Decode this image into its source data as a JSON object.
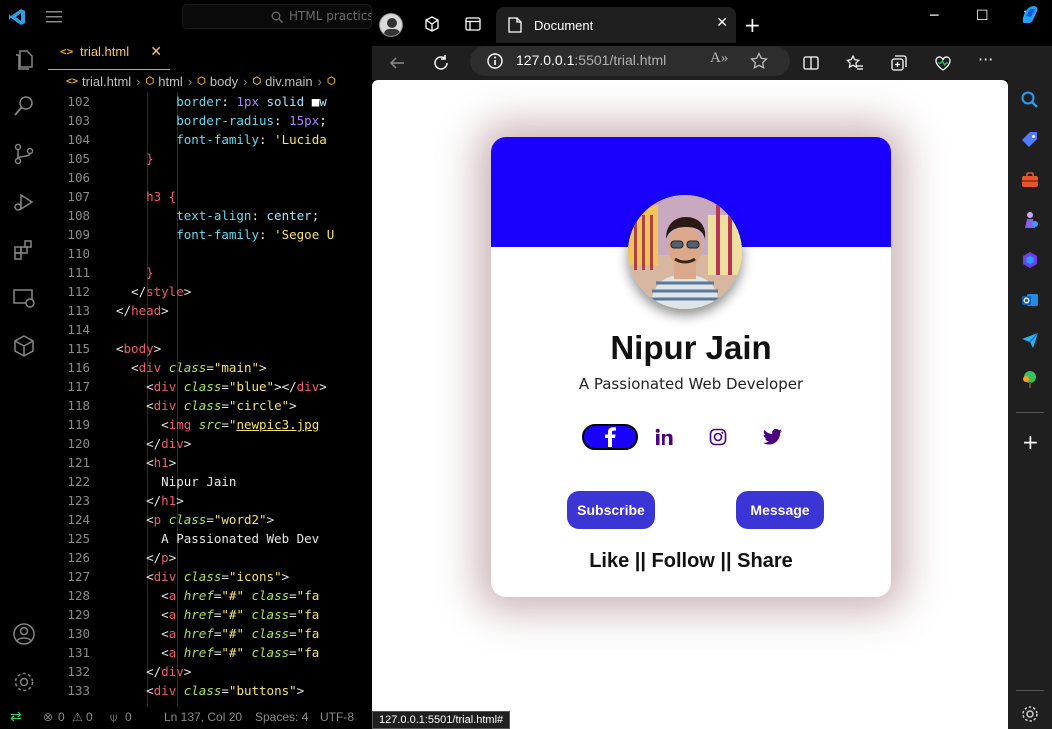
{
  "vscode": {
    "search_placeholder": "HTML practics",
    "tab": {
      "icon": "<>",
      "label": "trial.html",
      "close": "✕"
    },
    "breadcrumb": [
      "trial.html",
      "html",
      "body",
      "div.main"
    ],
    "lines": [
      {
        "n": "102",
        "html": "<span class='p'>        border</span>: <span class='n'>1px</span> <span class='v'>solid</span> <span class='w'>■</span><span class='v'>w</span>"
      },
      {
        "n": "103",
        "html": "<span class='p'>        border-radius</span>: <span class='n'>15px</span>;"
      },
      {
        "n": "104",
        "html": "<span class='p'>        font-family</span>: <span class='s'>'Lucida</span>"
      },
      {
        "n": "105",
        "html": "<span class='t'>    }</span>"
      },
      {
        "n": "106",
        "html": ""
      },
      {
        "n": "107",
        "html": "<span class='t'>    h3 {</span>"
      },
      {
        "n": "108",
        "html": "<span class='p'>        text-align</span>: <span class='v'>center</span>;"
      },
      {
        "n": "109",
        "html": "<span class='p'>        font-family</span>: <span class='s'>'Segoe U</span>"
      },
      {
        "n": "110",
        "html": ""
      },
      {
        "n": "111",
        "html": "<span class='t'>    }</span>"
      },
      {
        "n": "112",
        "html": "  &lt;/<span class='t'>style</span>&gt;"
      },
      {
        "n": "113",
        "html": "&lt;/<span class='t'>head</span>&gt;"
      },
      {
        "n": "114",
        "html": ""
      },
      {
        "n": "115",
        "html": "&lt;<span class='t'>body</span>&gt;"
      },
      {
        "n": "116",
        "html": "  &lt;<span class='t'>div</span> <span class='a'>class</span>=<span class='s'>\"main\"</span>&gt;"
      },
      {
        "n": "117",
        "html": "    &lt;<span class='t'>div</span> <span class='a'>class</span>=<span class='s'>\"blue\"</span>&gt;&lt;/<span class='t'>div</span>&gt;"
      },
      {
        "n": "118",
        "html": "    &lt;<span class='t'>div</span> <span class='a'>class</span>=<span class='s'>\"circle\"</span>&gt;"
      },
      {
        "n": "119",
        "html": "      &lt;<span class='t'>img</span> <span class='a'>src</span>=<span class='s'>\"<u>newpic3.jpg</u></span>"
      },
      {
        "n": "120",
        "html": "    &lt;/<span class='t'>div</span>&gt;"
      },
      {
        "n": "121",
        "html": "    &lt;<span class='t'>h1</span>&gt;"
      },
      {
        "n": "122",
        "html": "      Nipur Jain"
      },
      {
        "n": "123",
        "html": "    &lt;/<span class='t'>h1</span>&gt;"
      },
      {
        "n": "124",
        "html": "    &lt;<span class='t'>p</span> <span class='a'>class</span>=<span class='s'>\"word2\"</span>&gt;"
      },
      {
        "n": "125",
        "html": "      A Passionated Web Dev"
      },
      {
        "n": "126",
        "html": "    &lt;/<span class='t'>p</span>&gt;"
      },
      {
        "n": "127",
        "html": "    &lt;<span class='t'>div</span> <span class='a'>class</span>=<span class='s'>\"icons\"</span>&gt;"
      },
      {
        "n": "128",
        "html": "      &lt;<span class='t'>a</span> <span class='a'>href</span>=<span class='s'>\"#\"</span> <span class='a'>class</span>=<span class='s'>\"fa</span>"
      },
      {
        "n": "129",
        "html": "      &lt;<span class='t'>a</span> <span class='a'>href</span>=<span class='s'>\"#\"</span> <span class='a'>class</span>=<span class='s'>\"fa</span>"
      },
      {
        "n": "130",
        "html": "      &lt;<span class='t'>a</span> <span class='a'>href</span>=<span class='s'>\"#\"</span> <span class='a'>class</span>=<span class='s'>\"fa</span>"
      },
      {
        "n": "131",
        "html": "      &lt;<span class='t'>a</span> <span class='a'>href</span>=<span class='s'>\"#\"</span> <span class='a'>class</span>=<span class='s'>\"fa</span>"
      },
      {
        "n": "132",
        "html": "    &lt;/<span class='t'>div</span>&gt;"
      },
      {
        "n": "133",
        "html": "    &lt;<span class='t'>div</span> <span class='a'>class</span>=<span class='s'>\"buttons\"</span>&gt;"
      }
    ],
    "status": {
      "errors": "0",
      "warnings": "0",
      "ports": "0",
      "position": "Ln 137, Col 20",
      "spaces": "Spaces: 4",
      "encoding": "UTF-8"
    }
  },
  "browser": {
    "tab_title": "Document",
    "address_host": "127.0.0.1",
    "address_path": ":5501/trial.html",
    "hover_status": "127.0.0.1:5501/trial.html#"
  },
  "card": {
    "name": "Nipur Jain",
    "subtitle": "A Passionated Web Developer",
    "subscribe": "Subscribe",
    "message": "Message",
    "footer": "Like || Follow || Share",
    "colors": {
      "banner": "#1a00ff",
      "button": "#3b35d6",
      "icon": "#4b0082"
    }
  }
}
